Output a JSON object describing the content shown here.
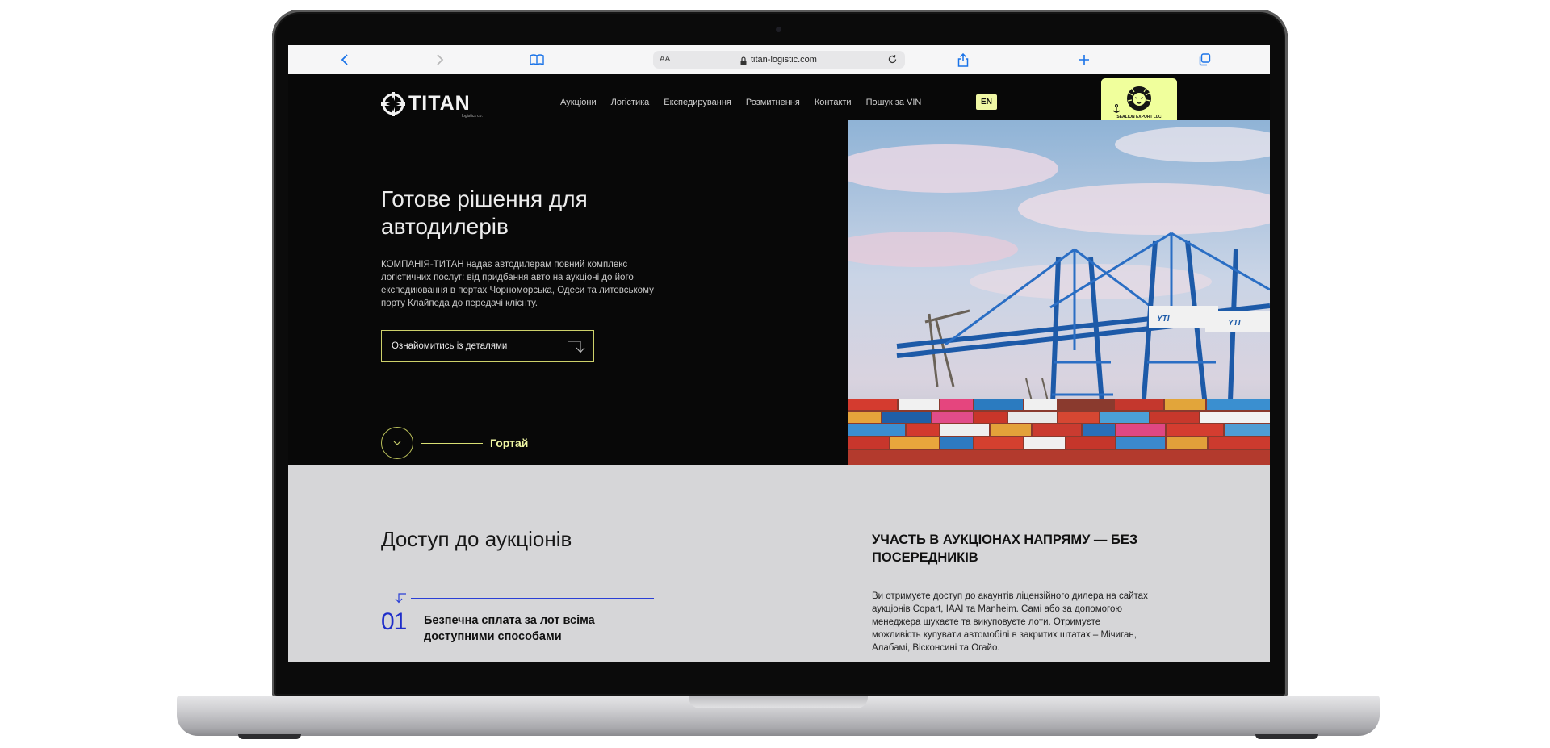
{
  "browser": {
    "aa_label": "AA",
    "url": "titan-logistic.com"
  },
  "site": {
    "logo_text": "TITAN",
    "logo_subtitle": "logistics co.",
    "nav": [
      {
        "label": "Аукціони"
      },
      {
        "label": "Логістика"
      },
      {
        "label": "Експедирування"
      },
      {
        "label": "Розмитнення"
      },
      {
        "label": "Контакти"
      },
      {
        "label": "Пошук за VIN"
      }
    ],
    "language": "EN",
    "partner_badge": "SEALION EXPORT LLC"
  },
  "hero": {
    "title": "Готове рішення для автодилерів",
    "text": "КОМПАНІЯ-ТИТАН надає автодилерам повний комплекс логістичних послуг: від придбання авто на аукціоні до його експедиювання в портах Чорноморська, Одеси та литовському порту Клайпеда до передачі клієнту.",
    "button_label": "Ознайомитись із деталями",
    "scroll_label": "Гортай"
  },
  "auction": {
    "title": "Доступ до аукціонів",
    "step_number": "01",
    "step_text": "Безпечна сплата за лот всіма доступними способами",
    "side_title": "УЧАСТЬ В АУКЦІОНАХ НАПРЯМУ — БЕЗ ПОСЕРЕДНИКІВ",
    "side_text": "Ви отримуєте доступ до акаунтів ліцензійного дилера на сайтах аукціонів Copart, IAAI та Manheim. Самі або за допомогою менеджера шукаєте та викуповуєте лоти. Отримуєте можливість купувати автомобілі в закритих штатах – Мічиган, Алабамі, Вісконсині та Огайо."
  },
  "colors": {
    "accent_yellow": "#f0f7a4",
    "accent_blue": "#1f2ec9",
    "hero_bg": "#080808",
    "section_bg": "#d6d6d8"
  }
}
